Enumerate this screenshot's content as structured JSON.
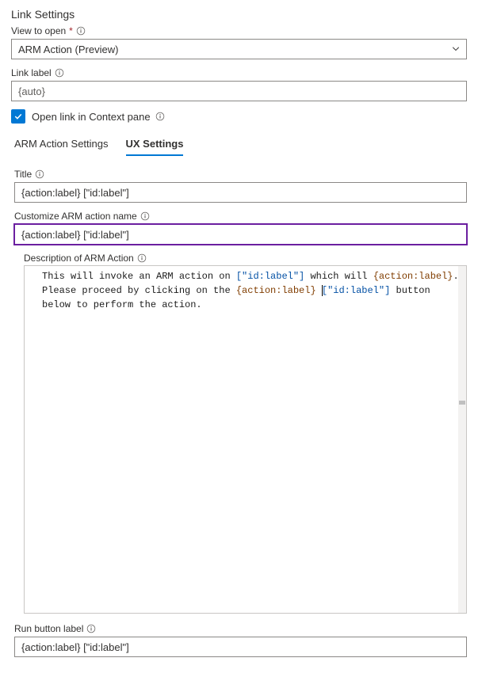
{
  "header": {
    "title": "Link Settings"
  },
  "view_to_open": {
    "label": "View to open",
    "required_marker": "*",
    "selected": "ARM Action (Preview)"
  },
  "link_label": {
    "label": "Link label",
    "value": "{auto}"
  },
  "context_pane": {
    "checked": true,
    "label": "Open link in Context pane"
  },
  "tabs": {
    "arm": "ARM Action Settings",
    "ux": "UX Settings",
    "active": "ux"
  },
  "ux": {
    "title_label": "Title",
    "title_value": "{action:label} [\"id:label\"]",
    "custom_name_label": "Customize ARM action name",
    "custom_name_value": "{action:label} [\"id:label\"]",
    "description_label": "Description of ARM Action",
    "description": {
      "pre1": "This will invoke an ARM action on ",
      "id1": "[\"id:label\"]",
      "mid1": " which will ",
      "act1": "{action:label}",
      "mid2": ". Please proceed by clicking on the ",
      "act2": "{action:label}",
      "sp": " ",
      "id2": "[\"id:label\"]",
      "tail": " button below to perform the action."
    },
    "run_label": "Run button label",
    "run_value": "{action:label} [\"id:label\"]"
  }
}
